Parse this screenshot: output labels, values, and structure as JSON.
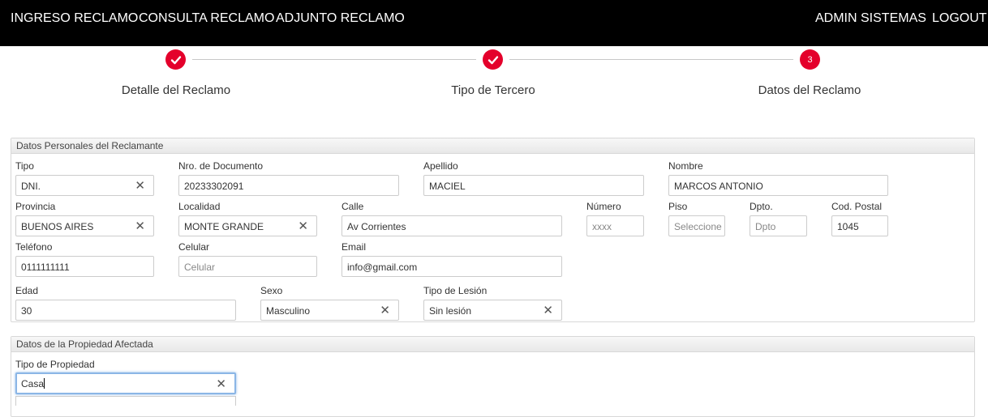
{
  "nav": {
    "ingreso": "INGRESO RECLAMO",
    "consulta": "CONSULTA RECLAMO",
    "adjunto": "ADJUNTO RECLAMO",
    "admin": "ADMIN SISTEMAS",
    "logout": "LOGOUT"
  },
  "colors": {
    "accent": "#e4002b",
    "topbar": "#000000",
    "focus": "#8bb6e6"
  },
  "steps": [
    {
      "label": "Detalle del Reclamo",
      "status": "done",
      "icon": "check-icon"
    },
    {
      "label": "Tipo de Tercero",
      "status": "done",
      "icon": "check-icon"
    },
    {
      "label": "Datos del Reclamo",
      "status": "current",
      "number": "3"
    }
  ],
  "personal": {
    "title": "Datos Personales del Reclamante",
    "tipo": {
      "label": "Tipo",
      "value": "DNI."
    },
    "documento": {
      "label": "Nro. de Documento",
      "value": "20233302091"
    },
    "apellido": {
      "label": "Apellido",
      "value": "MACIEL"
    },
    "nombre": {
      "label": "Nombre",
      "value": "MARCOS ANTONIO"
    },
    "provincia": {
      "label": "Provincia",
      "value": "BUENOS AIRES"
    },
    "localidad": {
      "label": "Localidad",
      "value": "MONTE GRANDE"
    },
    "calle": {
      "label": "Calle",
      "value": "Av Corrientes"
    },
    "numero": {
      "label": "Número",
      "placeholder": "xxxx"
    },
    "piso": {
      "label": "Piso",
      "placeholder": "Seleccione"
    },
    "dpto": {
      "label": "Dpto.",
      "placeholder": "Dpto"
    },
    "codpostal": {
      "label": "Cod. Postal",
      "value": "1045"
    },
    "telefono": {
      "label": "Teléfono",
      "value": "0111111111"
    },
    "celular": {
      "label": "Celular",
      "placeholder": "Celular"
    },
    "email": {
      "label": "Email",
      "value": "info@gmail.com"
    },
    "edad": {
      "label": "Edad",
      "value": "30"
    },
    "sexo": {
      "label": "Sexo",
      "value": "Masculino"
    },
    "lesion": {
      "label": "Tipo de Lesión",
      "value": "Sin lesión"
    }
  },
  "propiedad": {
    "title": "Datos de la Propiedad Afectada",
    "tipo": {
      "label": "Tipo de Propiedad",
      "value": "Casa"
    }
  },
  "clear_glyph": "✕"
}
